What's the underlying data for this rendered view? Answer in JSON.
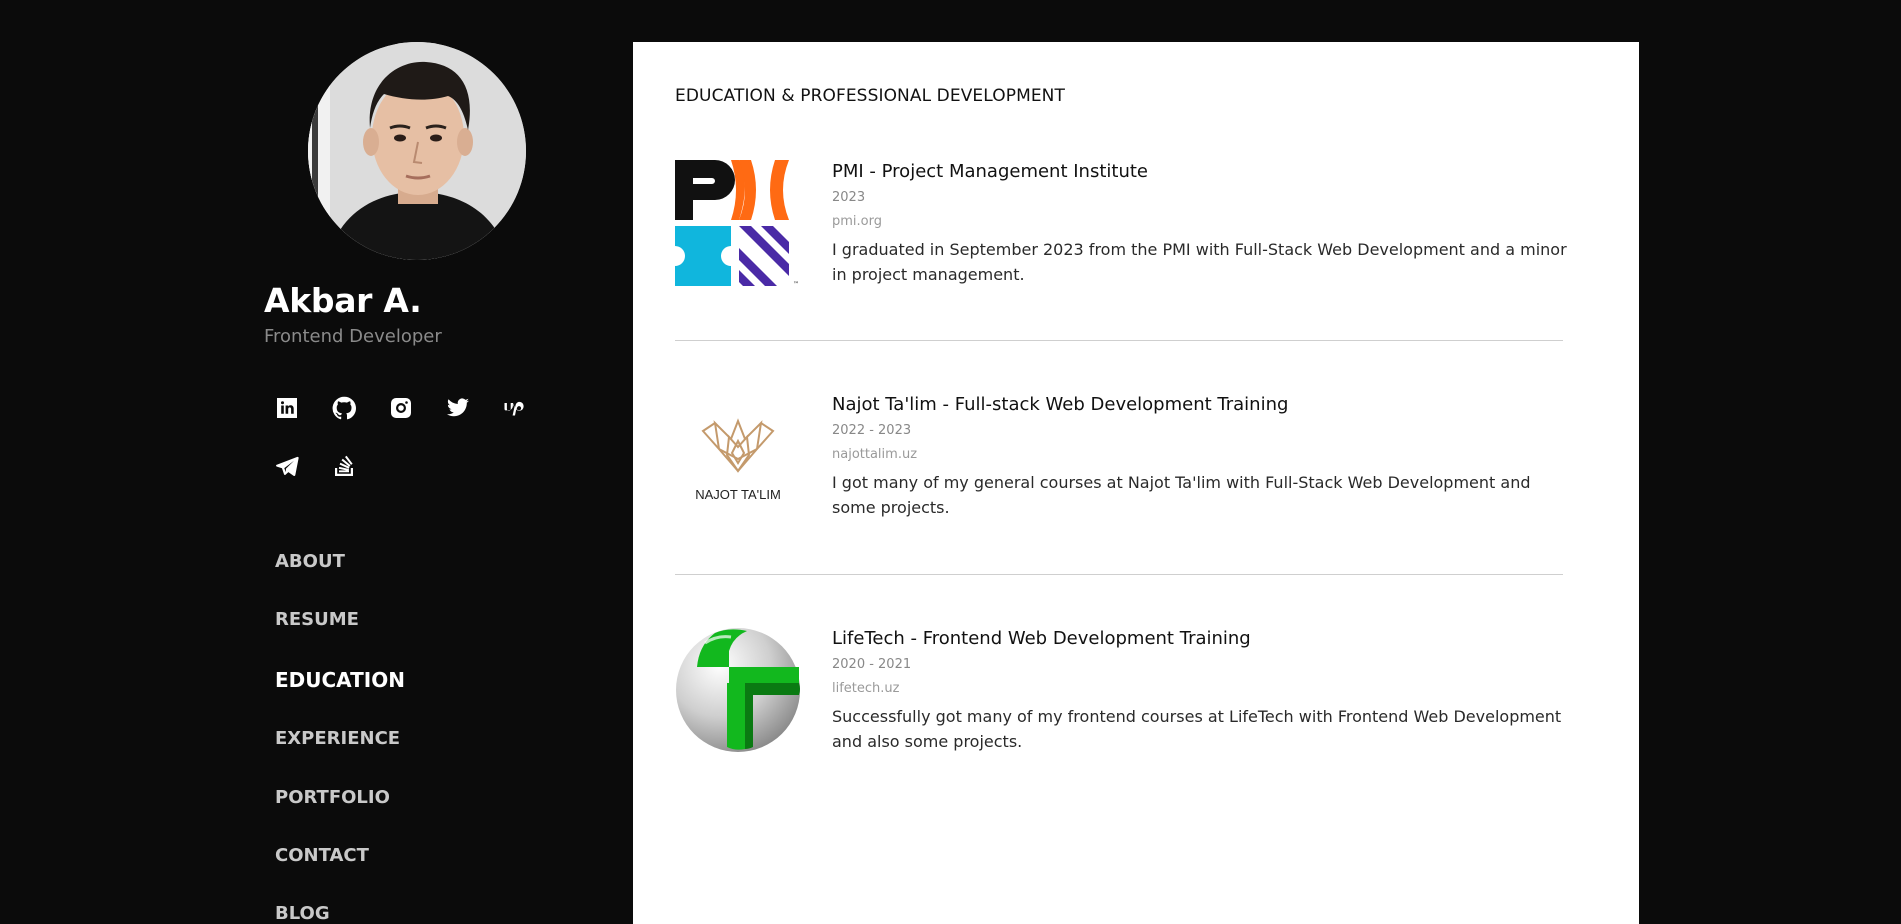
{
  "profile": {
    "name": "Akbar A.",
    "role": "Frontend Developer"
  },
  "social": [
    {
      "icon": "linkedin-icon"
    },
    {
      "icon": "github-icon"
    },
    {
      "icon": "instagram-icon"
    },
    {
      "icon": "twitter-icon"
    },
    {
      "icon": "upwork-icon"
    },
    {
      "icon": "telegram-icon"
    },
    {
      "icon": "stackoverflow-icon"
    }
  ],
  "nav": {
    "items": [
      "ABOUT",
      "RESUME",
      "EDUCATION",
      "EXPERIENCE",
      "PORTFOLIO",
      "CONTACT",
      "BLOG"
    ],
    "active": "EDUCATION"
  },
  "section": {
    "title": "EDUCATION & PROFESSIONAL DEVELOPMENT"
  },
  "education": [
    {
      "logo": "pmi-logo",
      "title": "PMI - Project Management Institute",
      "years": "2023",
      "site": "pmi.org",
      "description": "I graduated in September 2023 from the PMI with Full-Stack Web Development and a minor in project management."
    },
    {
      "logo": "najot-talim-logo",
      "logo_text": "NAJOT TA'LIM",
      "title": "Najot Ta'lim - Full-stack Web Development Training",
      "years": "2022 - 2023",
      "site": "najottalim.uz",
      "description": "I got many of my general courses at Najot Ta'lim with Full-Stack Web Development and some projects."
    },
    {
      "logo": "lifetech-logo",
      "title": "LifeTech - Frontend Web Development Training",
      "years": "2020 - 2021",
      "site": "lifetech.uz",
      "description": "Successfully got many of my frontend courses at LifeTech with Frontend Web Development and also some projects."
    }
  ],
  "colors": {
    "page_background": "#0b0b0b",
    "card_background": "#ffffff",
    "pmi_black": "#111111",
    "pmi_orange": "#ff6a13",
    "pmi_cyan": "#10b6dd",
    "pmi_purple": "#4a2aa6",
    "najot_gold": "#c49a6c",
    "lifetech_green": "#12b81e"
  }
}
